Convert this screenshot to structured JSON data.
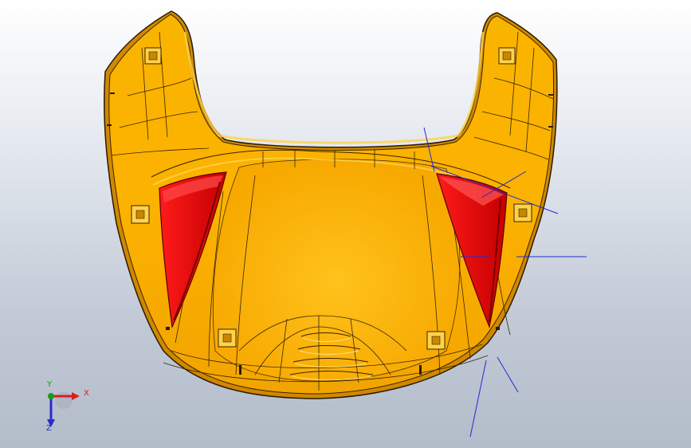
{
  "window": {
    "title": ""
  },
  "model": {
    "part": "hood-cover",
    "colors": {
      "body": "#f6a800",
      "body_light": "#ffd04a",
      "body_dark": "#c97f00",
      "edge": "#2a1a00",
      "vent_red": "#e00000",
      "vent_dark": "#8a0000",
      "background_top": "#ffffff",
      "background_bottom": "#b3bcc9",
      "construction_line": "#1f2bd6"
    }
  },
  "triad": {
    "x_label": "X",
    "y_label": "Y",
    "z_label": "Z",
    "x_color": "#d42020",
    "y_color": "#1a9a1a",
    "z_color": "#2b2bd0"
  }
}
